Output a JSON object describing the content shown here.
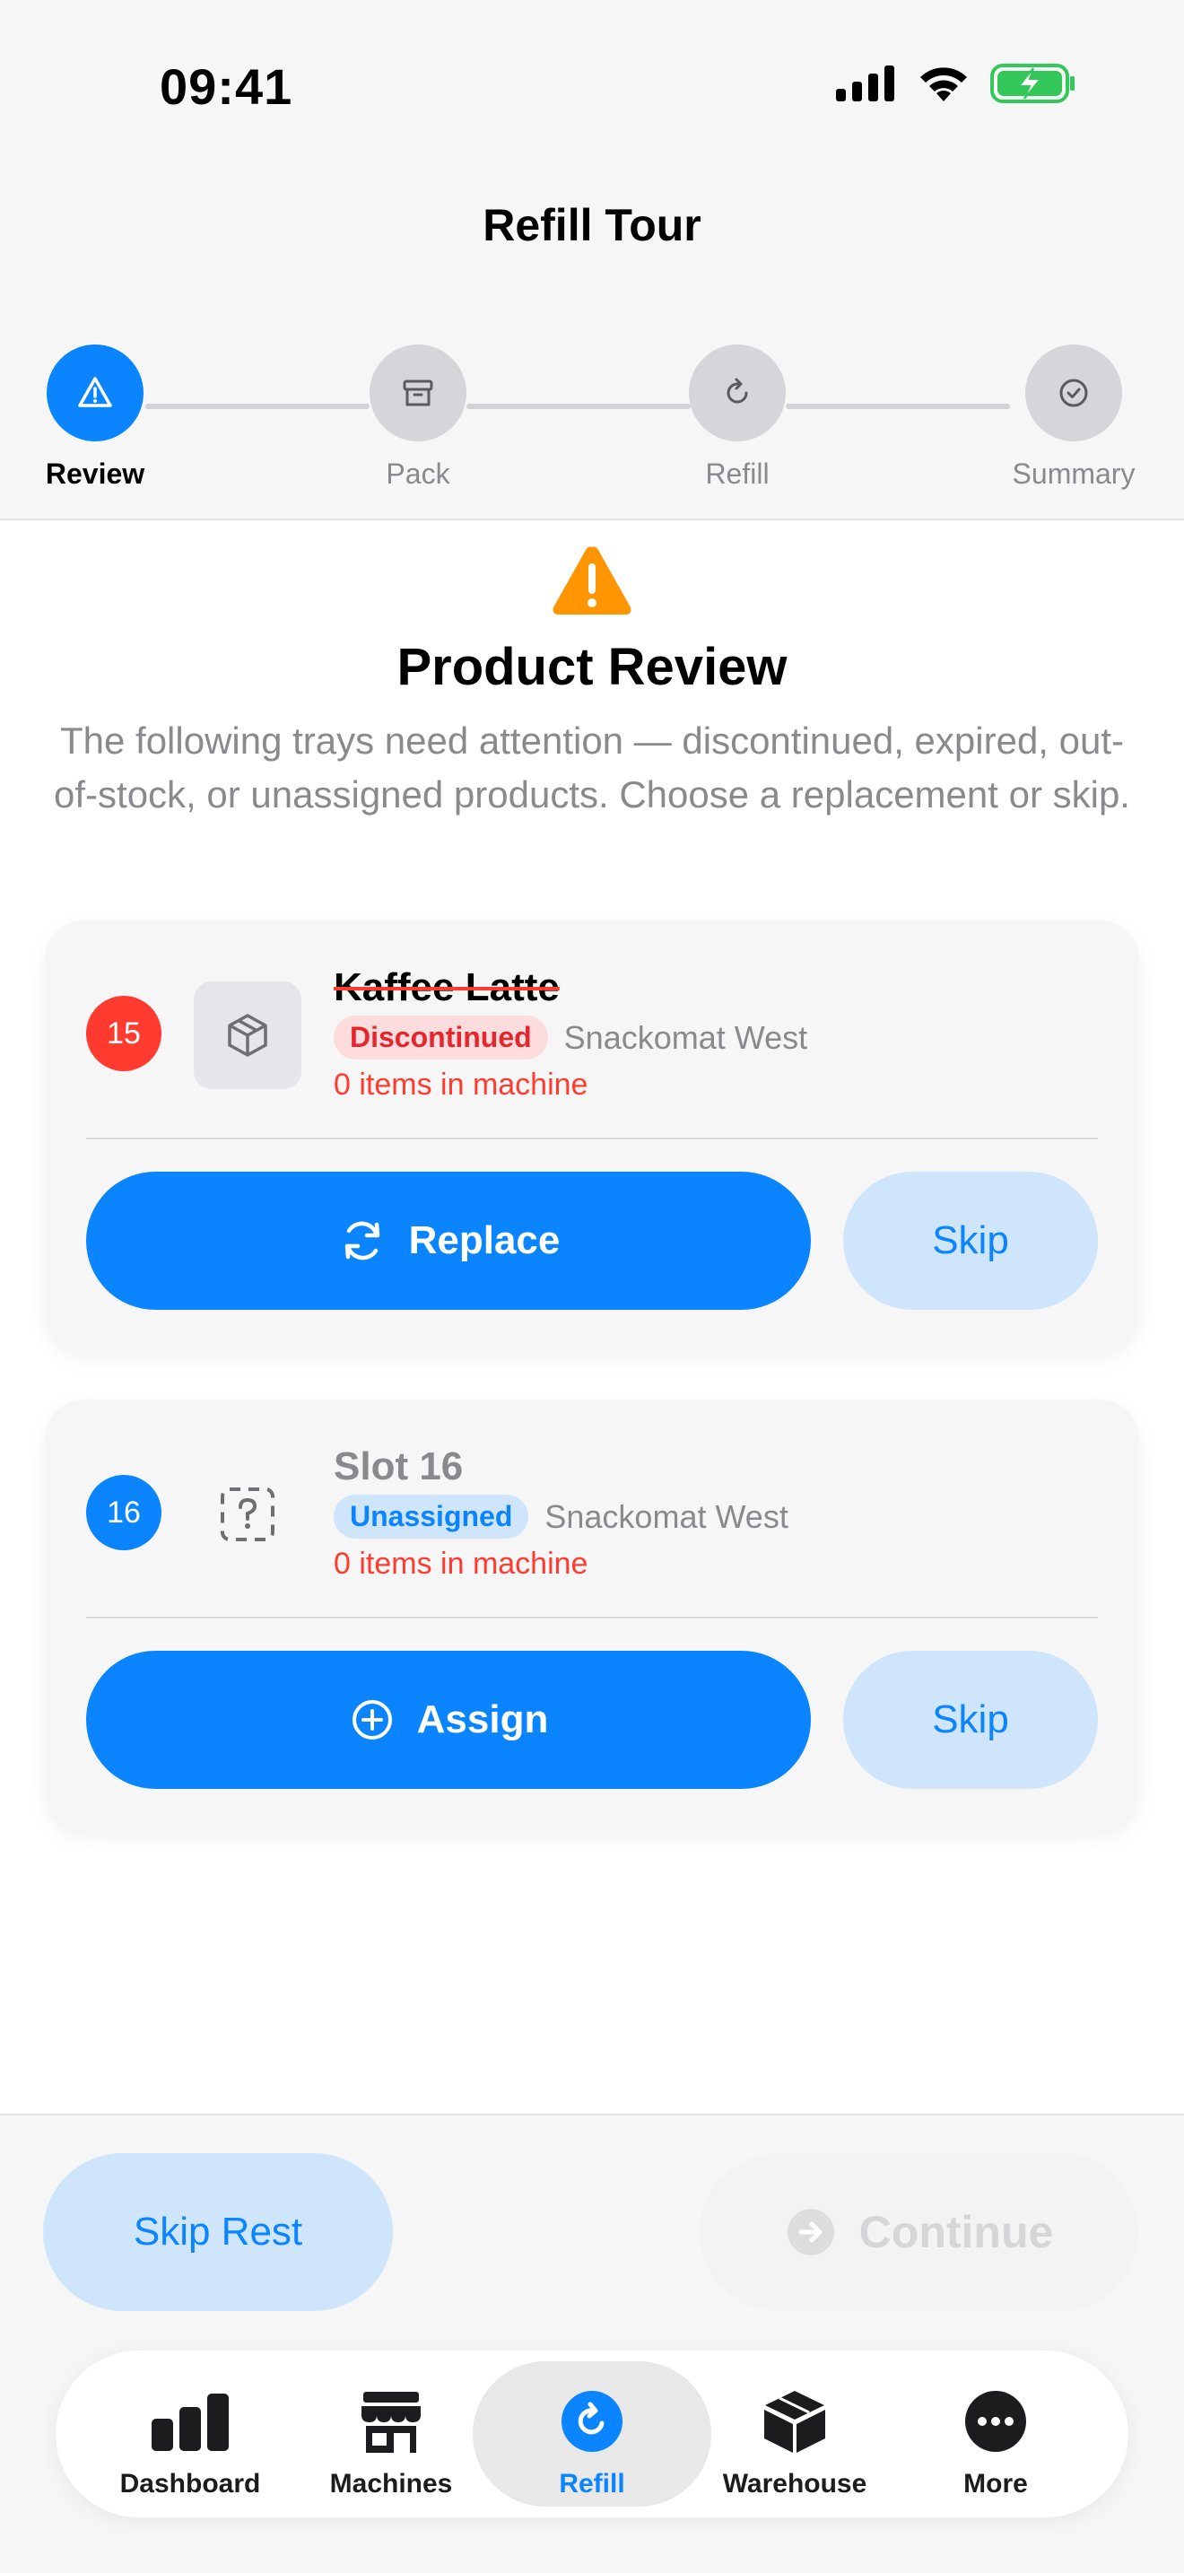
{
  "status_bar": {
    "time": "09:41",
    "battery_color": "#34c759"
  },
  "header": {
    "title": "Refill Tour"
  },
  "stepper": {
    "steps": [
      {
        "label": "Review",
        "icon": "warning-triangle-icon",
        "active": true
      },
      {
        "label": "Pack",
        "icon": "archive-box-icon",
        "active": false
      },
      {
        "label": "Refill",
        "icon": "refresh-icon",
        "active": false
      },
      {
        "label": "Summary",
        "icon": "checkmark-circle-icon",
        "active": false
      }
    ]
  },
  "review": {
    "icon": "warning-triangle-icon",
    "title": "Product Review",
    "description": "The following trays need attention — discontinued, expired, out-of-stock, or unassigned products. Choose a replacement or skip."
  },
  "trays": [
    {
      "slot": "15",
      "slot_color": "#ff3b30",
      "product_name": "Kaffee Latte",
      "status": "Discontinued",
      "machine": "Snackomat West",
      "stock": "0 items in machine",
      "primary_action": "Replace",
      "secondary_action": "Skip"
    },
    {
      "slot": "16",
      "slot_color": "#0a84ff",
      "product_name": "Slot 16",
      "status": "Unassigned",
      "machine": "Snackomat West",
      "stock": "0 items in machine",
      "primary_action": "Assign",
      "secondary_action": "Skip"
    }
  ],
  "actions": {
    "skip_rest": "Skip Rest",
    "continue": "Continue"
  },
  "tabbar": {
    "tabs": [
      {
        "label": "Dashboard",
        "icon": "chart-bar-icon"
      },
      {
        "label": "Machines",
        "icon": "storefront-icon"
      },
      {
        "label": "Refill",
        "icon": "refresh-circle-icon",
        "active": true
      },
      {
        "label": "Warehouse",
        "icon": "cube-icon"
      },
      {
        "label": "More",
        "icon": "ellipsis-circle-icon"
      }
    ]
  },
  "colors": {
    "accent": "#0a84ff",
    "danger": "#ff3b30",
    "warning": "#ff9500"
  }
}
